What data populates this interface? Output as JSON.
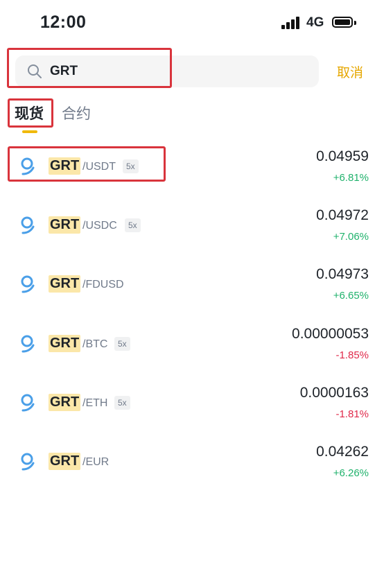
{
  "status_bar": {
    "time": "12:00",
    "network": "4G"
  },
  "search": {
    "value": "GRT",
    "cancel_label": "取消"
  },
  "tabs": [
    {
      "label": "现货",
      "active": true
    },
    {
      "label": "合约",
      "active": false
    }
  ],
  "colors": {
    "accent": "#f0b90b",
    "up": "#20b26c",
    "down": "#e0294a",
    "highlight": "#d9343c"
  },
  "pairs": [
    {
      "base": "GRT",
      "quote": "/USDT",
      "leverage": "5x",
      "price": "0.04959",
      "change": "+6.81%",
      "direction": "up"
    },
    {
      "base": "GRT",
      "quote": "/USDC",
      "leverage": "5x",
      "price": "0.04972",
      "change": "+7.06%",
      "direction": "up"
    },
    {
      "base": "GRT",
      "quote": "/FDUSD",
      "leverage": "",
      "price": "0.04973",
      "change": "+6.65%",
      "direction": "up"
    },
    {
      "base": "GRT",
      "quote": "/BTC",
      "leverage": "5x",
      "price": "0.00000053",
      "change": "-1.85%",
      "direction": "down"
    },
    {
      "base": "GRT",
      "quote": "/ETH",
      "leverage": "5x",
      "price": "0.0000163",
      "change": "-1.81%",
      "direction": "down"
    },
    {
      "base": "GRT",
      "quote": "/EUR",
      "leverage": "",
      "price": "0.04262",
      "change": "+6.26%",
      "direction": "up"
    }
  ]
}
